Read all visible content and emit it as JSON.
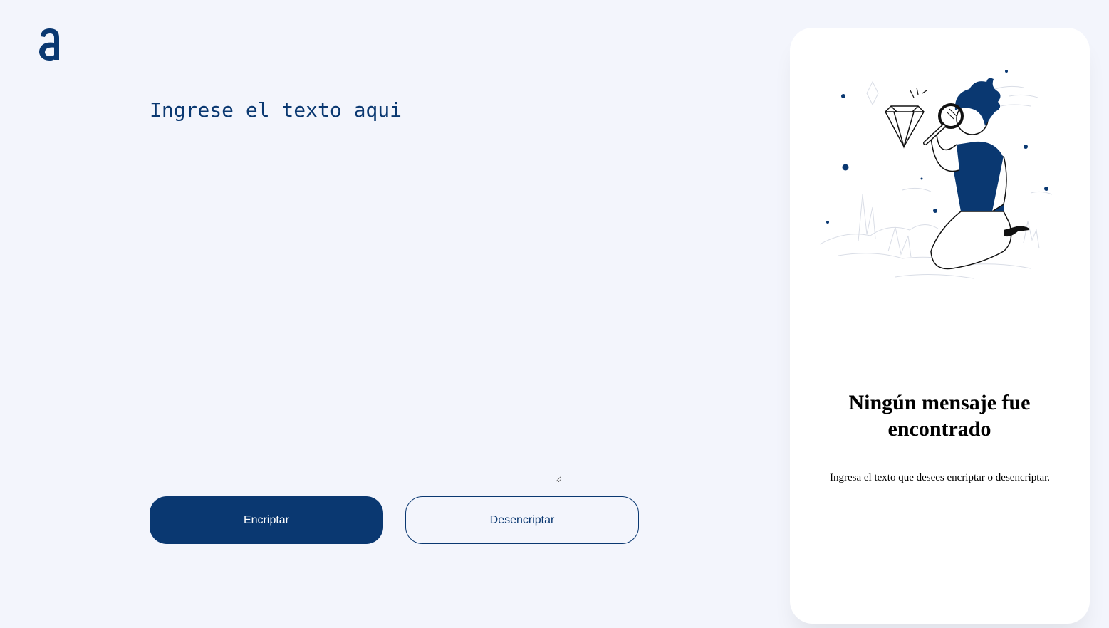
{
  "brand": {
    "logo_icon": "alura-logo-icon",
    "accent_color": "#0a3871"
  },
  "input": {
    "placeholder": "Ingrese el texto aqui",
    "value": ""
  },
  "actions": {
    "encrypt_label": "Encriptar",
    "decrypt_label": "Desencriptar"
  },
  "result_panel": {
    "illustration_icon": "search-person-illustration",
    "title": "Ningún mensaje fue encontrado",
    "message": "Ingresa el texto que desees encriptar o desencriptar."
  }
}
